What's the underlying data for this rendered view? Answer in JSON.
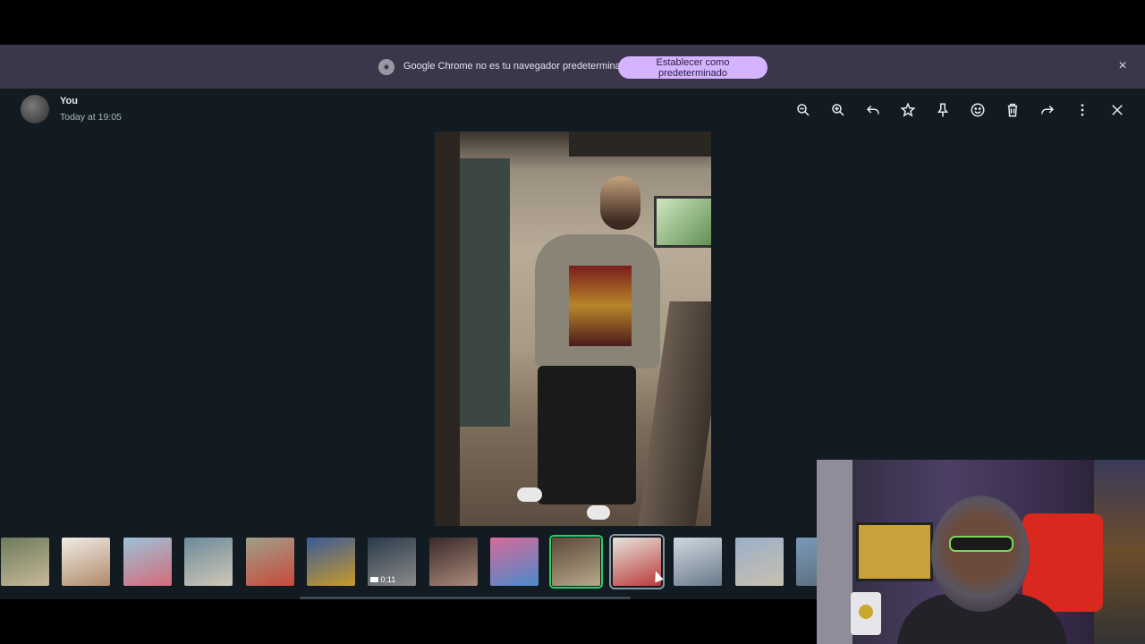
{
  "banner": {
    "message": "Google Chrome no es tu navegador predeterminado",
    "set_default_label": "Establecer como predeterminado",
    "close_label": "×"
  },
  "header": {
    "sender": "You",
    "timestamp": "Today at 19:05"
  },
  "toolbar": {
    "icons": [
      "zoom-out-icon",
      "zoom-in-icon",
      "reply-icon",
      "star-icon",
      "pin-icon",
      "react-icon",
      "delete-icon",
      "forward-icon",
      "more-icon",
      "close-icon"
    ]
  },
  "thumbnails": [
    {
      "type": "photo",
      "colors": [
        "#6b7b5a",
        "#c9b99a"
      ]
    },
    {
      "type": "photo",
      "colors": [
        "#f0ece6",
        "#b08a6a"
      ]
    },
    {
      "type": "photo",
      "colors": [
        "#9cc3d8",
        "#d46a7a"
      ]
    },
    {
      "type": "photo",
      "colors": [
        "#6b8a9a",
        "#d0c8b8"
      ]
    },
    {
      "type": "photo",
      "colors": [
        "#a0a08a",
        "#c84a3a"
      ]
    },
    {
      "type": "photo",
      "colors": [
        "#3a5a9a",
        "#c89a2a"
      ]
    },
    {
      "type": "video",
      "duration": "0:11",
      "colors": [
        "#2a3a4a",
        "#8a8a8a"
      ]
    },
    {
      "type": "photo",
      "colors": [
        "#3a2a2a",
        "#aa8a7a"
      ]
    },
    {
      "type": "photo",
      "colors": [
        "#d86a9a",
        "#4a8acb"
      ]
    },
    {
      "type": "photo",
      "state": "current",
      "colors": [
        "#5a4a3a",
        "#b8a88a"
      ]
    },
    {
      "type": "photo",
      "state": "hover",
      "colors": [
        "#e8e4dc",
        "#b83a3a"
      ]
    },
    {
      "type": "photo",
      "colors": [
        "#cfd8e0",
        "#6a7a8a"
      ]
    },
    {
      "type": "photo",
      "colors": [
        "#9ab0c8",
        "#c8c0b0"
      ]
    },
    {
      "type": "photo",
      "colors": [
        "#7a9ab8",
        "#5a6a7a"
      ]
    }
  ]
}
